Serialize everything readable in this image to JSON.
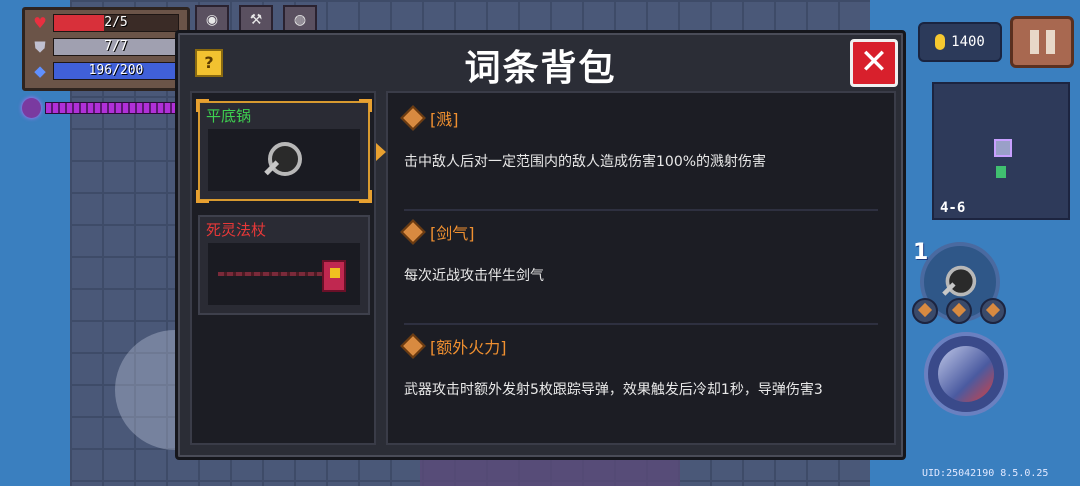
{
  "hud": {
    "hp": {
      "label": "2/5",
      "fraction": 0.4,
      "color": "#d8303a"
    },
    "armor": {
      "label": "7/7",
      "fraction": 1.0,
      "color": "#a0a0b0"
    },
    "energy": {
      "label": "196/200",
      "fraction": 0.98,
      "color": "#4060d8"
    },
    "coins": "1400",
    "level": "4-6",
    "weapon_slot_number": "1",
    "uid": "UID:25042190 8.5.0.25"
  },
  "dialog": {
    "title": "词条背包",
    "help_label": "?",
    "close_label": "✕"
  },
  "items": [
    {
      "name": "平底锅",
      "color": "green",
      "selected": true,
      "icon": "frying-pan-icon"
    },
    {
      "name": "死灵法杖",
      "color": "red",
      "selected": false,
      "icon": "staff-icon"
    }
  ],
  "affixes": [
    {
      "name": "[溅]",
      "description": "击中敌人后对一定范围内的敌人造成伤害100%的溅射伤害"
    },
    {
      "name": "[剑气]",
      "description": "每次近战攻击伴生剑气"
    },
    {
      "name": "[额外火力]",
      "description": "武器攻击时额外发射5枚跟踪导弹，效果触发后冷却1秒，导弹伤害3"
    }
  ]
}
